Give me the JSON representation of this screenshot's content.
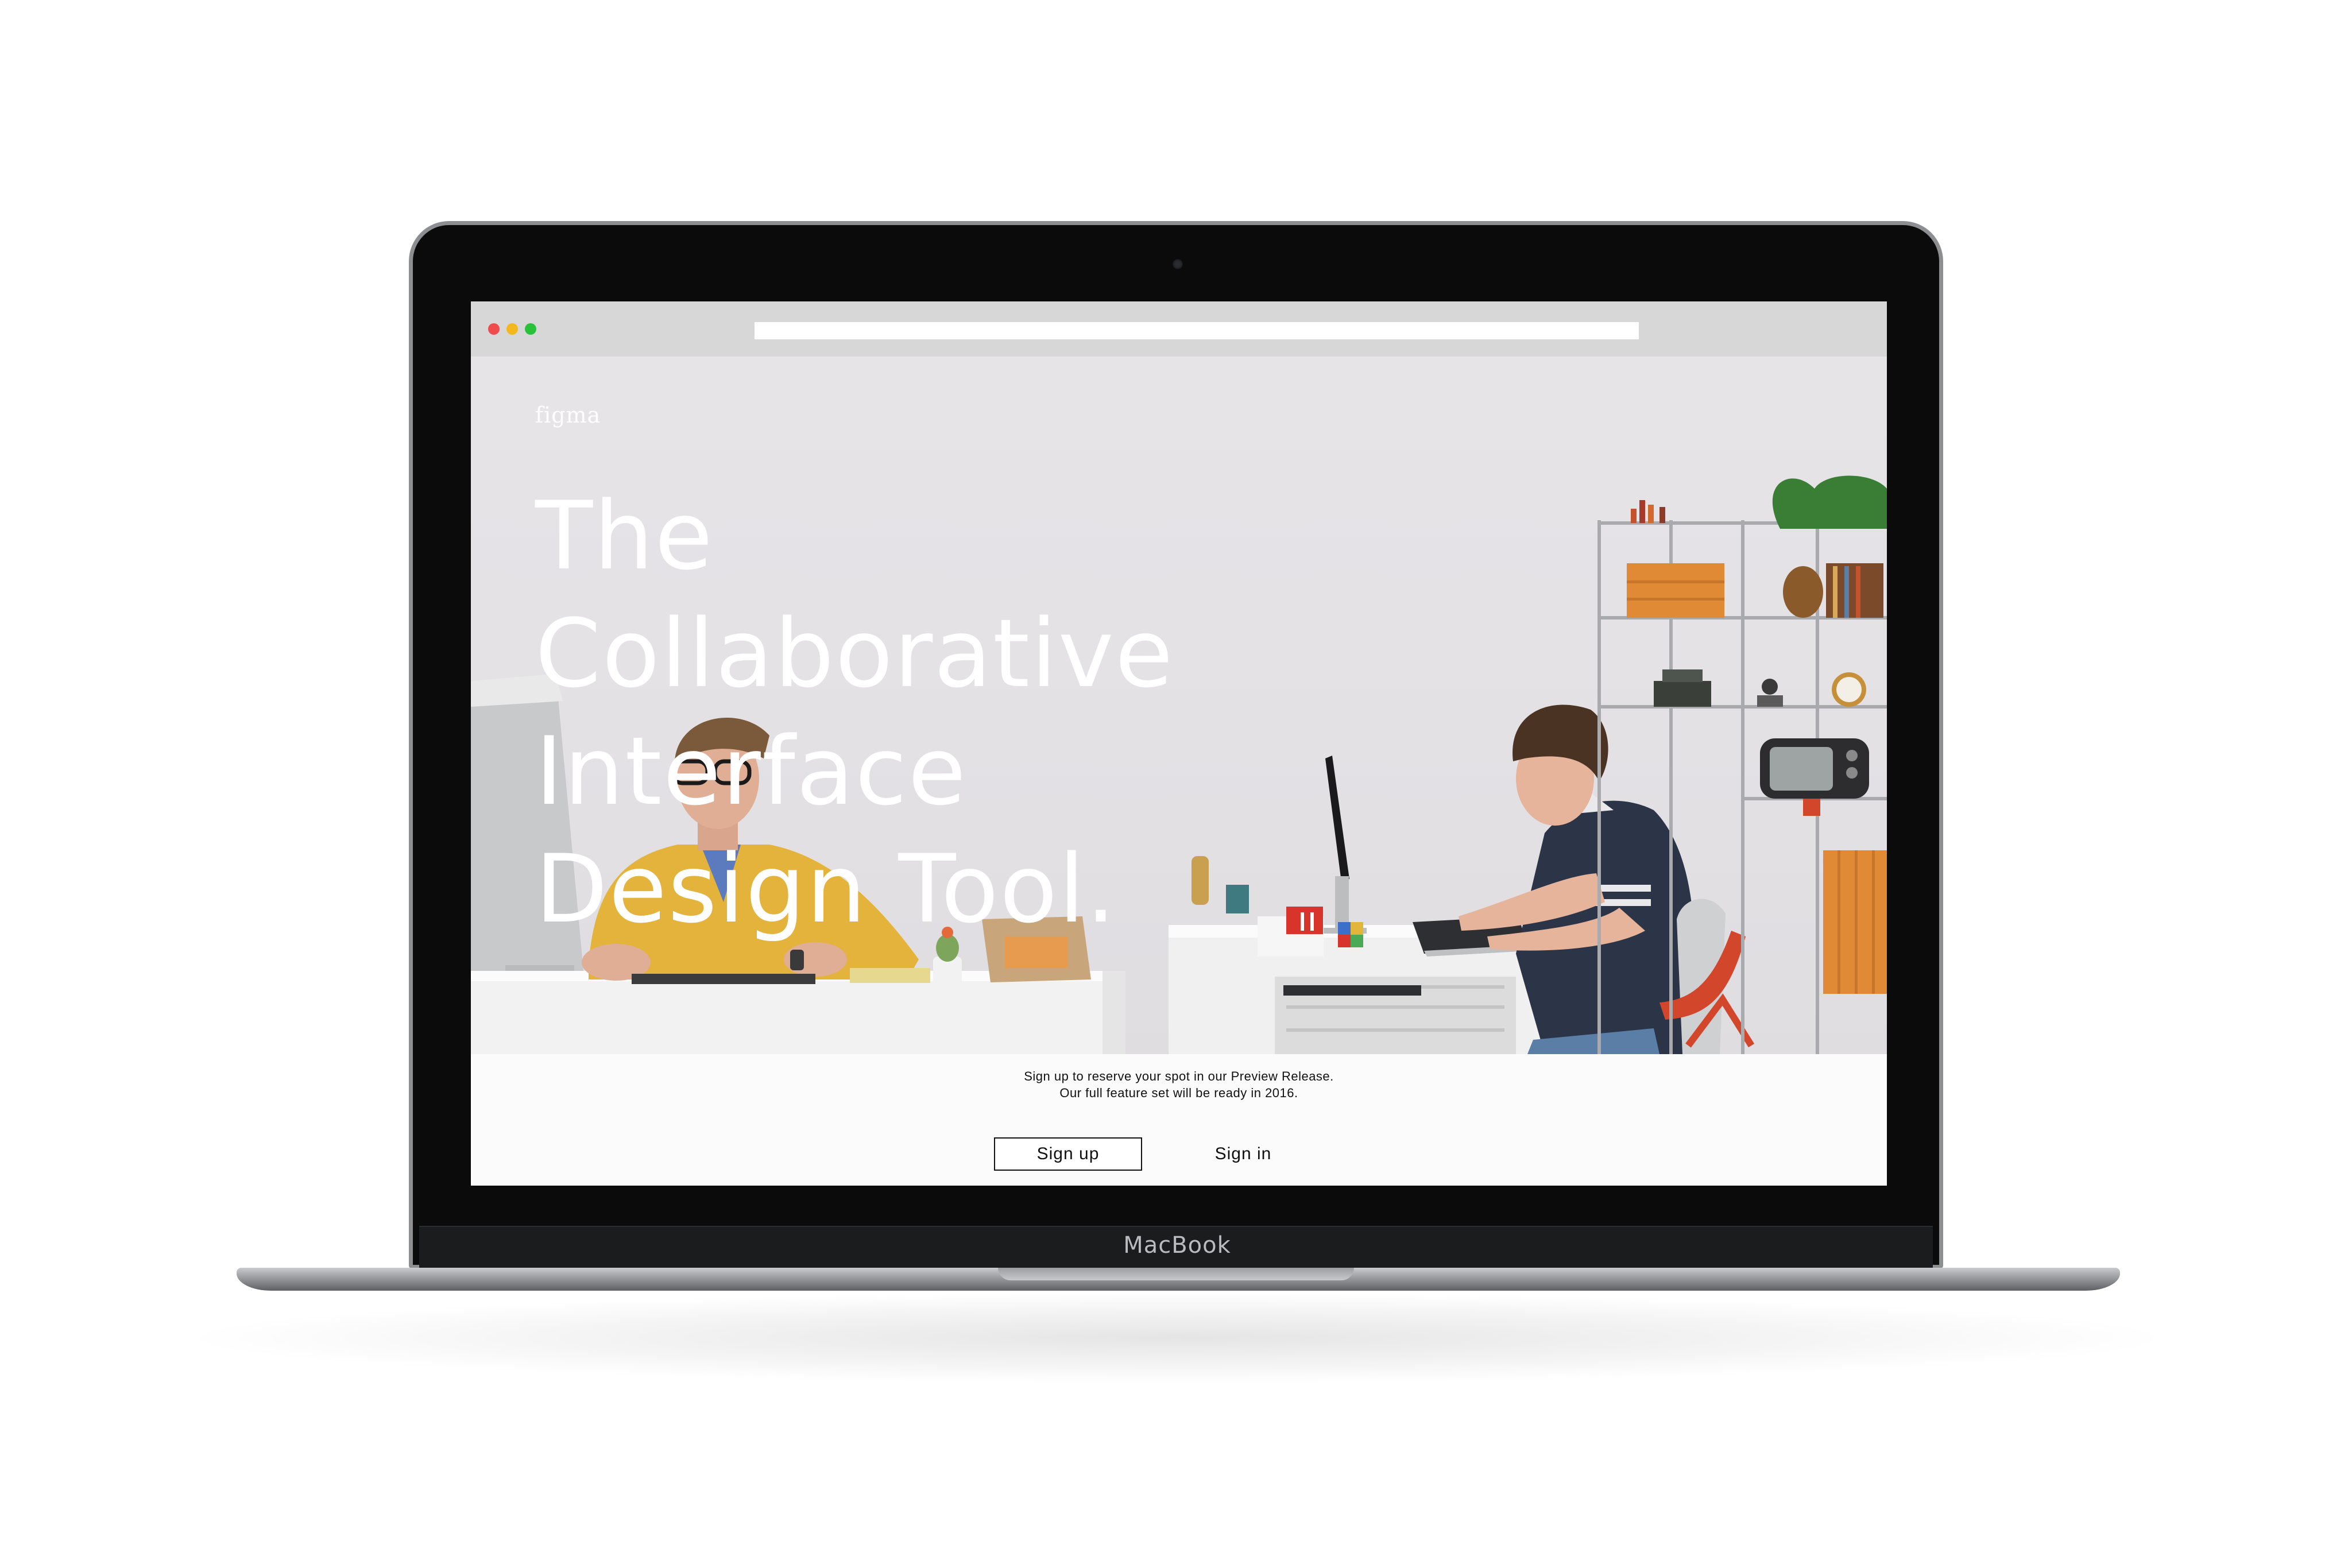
{
  "device": {
    "brand_label": "MacBook"
  },
  "browser": {
    "window_controls": [
      "close",
      "minimize",
      "zoom"
    ],
    "address_bar_value": ""
  },
  "page": {
    "logo": "figma",
    "headline_lines": [
      "The",
      "Collaborative",
      "Interface",
      "Design Tool."
    ],
    "cta": {
      "line1": "Sign up to reserve your spot in our Preview Release.",
      "line2": "Our full feature set will be ready in 2016.",
      "signup_label": "Sign up",
      "signin_label": "Sign in"
    }
  },
  "colors": {
    "close_dot": "#ef4b4c",
    "minimize_dot": "#f3b81e",
    "zoom_dot": "#27c13a",
    "hero_bg": "#e4e2e5",
    "sweater": "#e3b13a",
    "shirt_navy": "#2c3447",
    "chair_red": "#d2472c"
  }
}
